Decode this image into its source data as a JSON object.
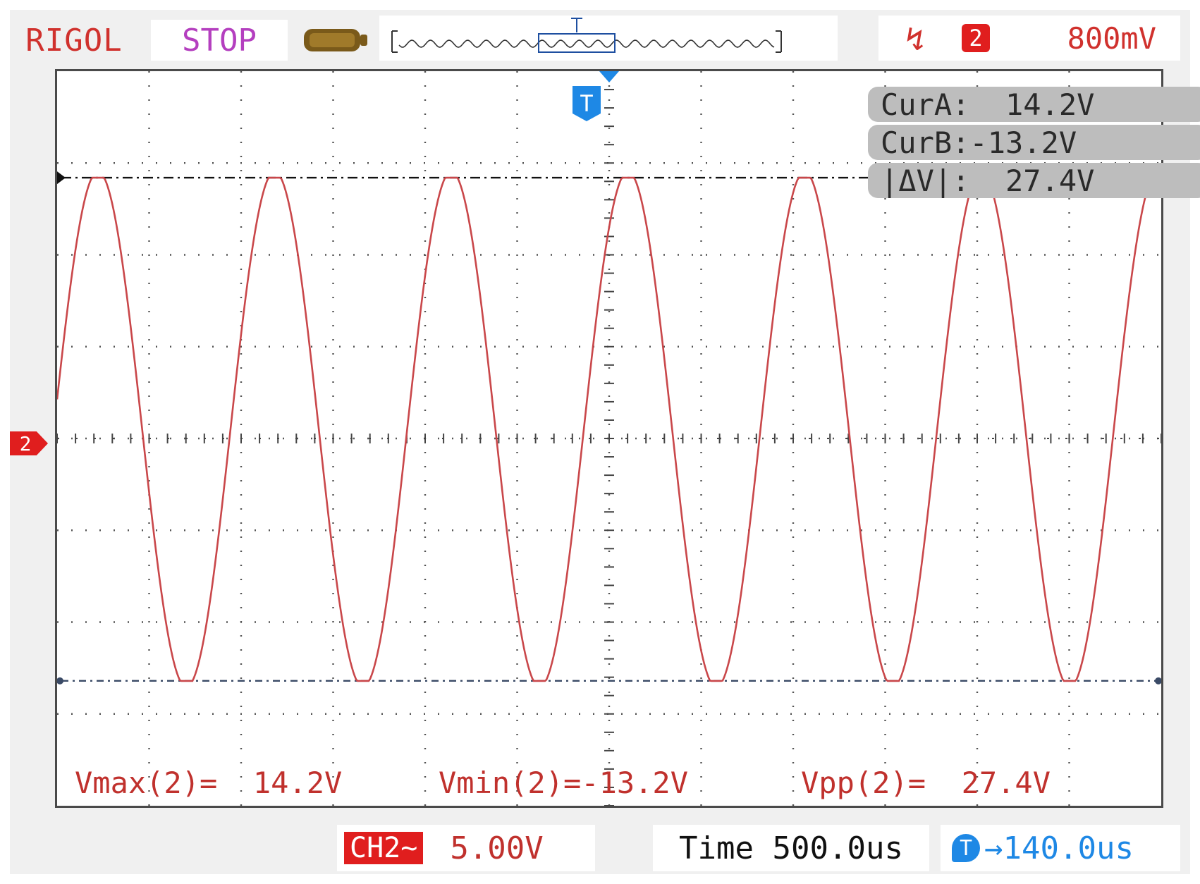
{
  "header": {
    "brand": "RIGOL",
    "run_status": "STOP",
    "trigger_channel": "2",
    "trigger_level": "800mV"
  },
  "channel_marker": "2",
  "trigger_marker": "T",
  "cursors": {
    "cur_a": "CurA:  14.2V",
    "cur_b": "CurB:-13.2V",
    "delta": "|ΔV|:  27.4V"
  },
  "measurements": {
    "vmax": "Vmax(2)=  14.2V",
    "vmin": "Vmin(2)=-13.2V",
    "vpp": "Vpp(2)=  27.4V"
  },
  "footer": {
    "channel_label": "CH2~",
    "volts_per_div": "5.00V",
    "time_base": "Time 500.0us",
    "trigger_offset": "140.0us"
  },
  "colors": {
    "trace": "#c9474a",
    "cursor_a": "#111111",
    "cursor_b": "#3a4a66",
    "brand": "#d0312d",
    "trigger_blue": "#1e88e5"
  },
  "waveform": {
    "vmax": 14.2,
    "vmin": -13.2,
    "volts_per_div": 5.0,
    "cycles_on_screen": 6.25
  }
}
